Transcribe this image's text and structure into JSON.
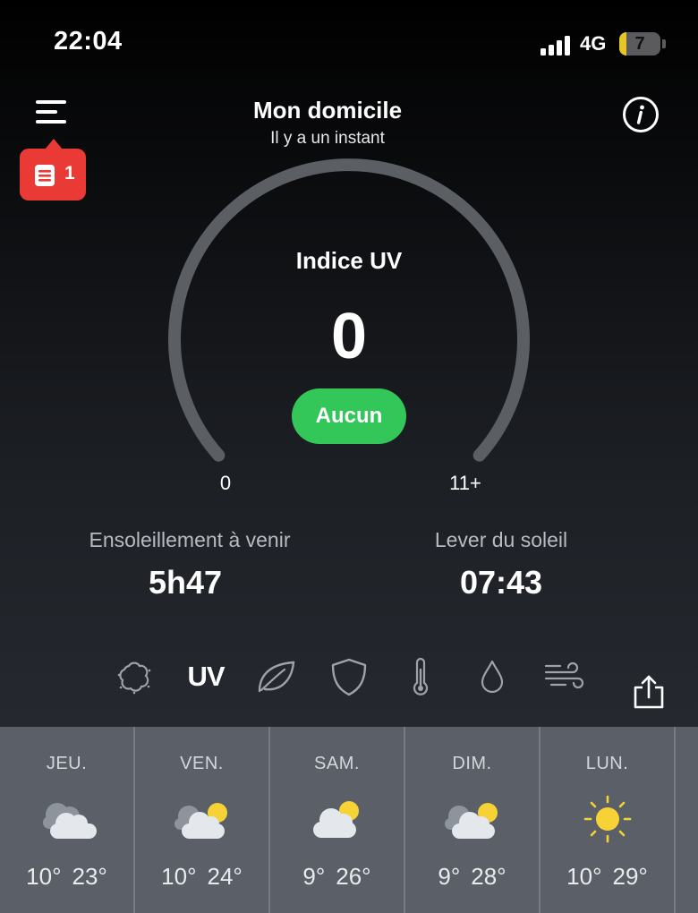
{
  "status_bar": {
    "time": "22:04",
    "network": "4G",
    "battery": "7",
    "battery_fill_color": "#e6c627"
  },
  "header": {
    "title": "Mon domicile",
    "subtitle": "Il y a un instant",
    "notification_count": "1",
    "menu_icon": "menu-icon",
    "info_icon": "info-icon"
  },
  "gauge": {
    "title": "Indice UV",
    "value": "0",
    "level": 0,
    "level_label": "Aucun",
    "level_color": "#33c759",
    "min_label": "0",
    "max_label": "11+"
  },
  "stats": [
    {
      "label": "Ensoleillement à venir",
      "value": "5h47"
    },
    {
      "label": "Lever du soleil",
      "value": "07:43"
    }
  ],
  "tabs": [
    {
      "name": "pollen",
      "icon": "pollen-cloud-icon"
    },
    {
      "name": "uv",
      "label": "UV",
      "selected": true
    },
    {
      "name": "air-quality",
      "icon": "leaf-icon"
    },
    {
      "name": "protection",
      "icon": "shield-icon"
    },
    {
      "name": "temperature",
      "icon": "thermometer-icon"
    },
    {
      "name": "humidity",
      "icon": "droplet-icon"
    },
    {
      "name": "wind",
      "icon": "wind-icon"
    }
  ],
  "share_icon": "share-icon",
  "forecast": [
    {
      "day": "JEU.",
      "min": "10°",
      "max": "23°",
      "icon": "cloudy-icon"
    },
    {
      "day": "VEN.",
      "min": "10°",
      "max": "24°",
      "icon": "partly-cloudy-icon"
    },
    {
      "day": "SAM.",
      "min": "9°",
      "max": "26°",
      "icon": "partly-cloudy-icon"
    },
    {
      "day": "DIM.",
      "min": "9°",
      "max": "28°",
      "icon": "partly-cloudy-icon"
    },
    {
      "day": "LUN.",
      "min": "10°",
      "max": "29°",
      "icon": "sunny-icon"
    }
  ],
  "colors": {
    "accent_green": "#33c759",
    "notification_red": "#ea3a36",
    "sun_yellow": "#f6d236"
  }
}
